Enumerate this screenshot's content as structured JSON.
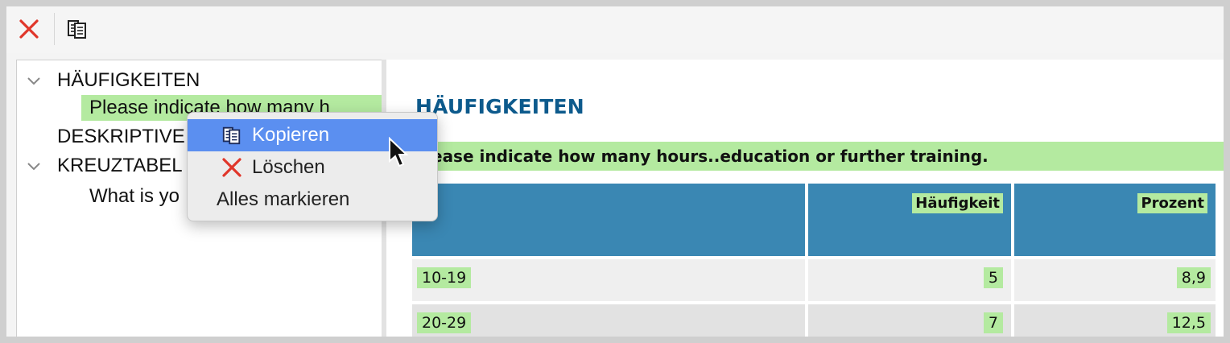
{
  "toolbar": {
    "delete_icon": "close-x-red-icon",
    "copy_icon": "copy-document-icon"
  },
  "tree": {
    "items": [
      {
        "label": "HÄUFIGKEITEN",
        "expanded": true
      },
      {
        "label": "Please indicate how many h",
        "selected": true
      },
      {
        "label": "DESKRIPTIVE"
      },
      {
        "label": "KREUZTABEL",
        "expanded": true
      },
      {
        "label": "What is yo"
      }
    ]
  },
  "context_menu": {
    "items": [
      {
        "label": "Kopieren",
        "icon": "copy-document-icon",
        "highlighted": true
      },
      {
        "label": "Löschen",
        "icon": "close-x-red-icon"
      },
      {
        "label": "Alles markieren"
      }
    ]
  },
  "content": {
    "heading": "HÄUFIGKEITEN",
    "table_title": "ease indicate how many hours..education or further training.",
    "columns": [
      "",
      "Häufigkeit",
      "Prozent"
    ],
    "rows": [
      {
        "label": "10-19",
        "freq": "5",
        "pct": "8,9"
      },
      {
        "label": "20-29",
        "freq": "7",
        "pct": "12,5"
      }
    ]
  },
  "colors": {
    "highlight_green": "#b4eaa0",
    "header_blue": "#3a87b3",
    "heading_blue": "#0d5a8c",
    "menu_highlight": "#5b8ff0",
    "delete_red": "#e0362a"
  }
}
